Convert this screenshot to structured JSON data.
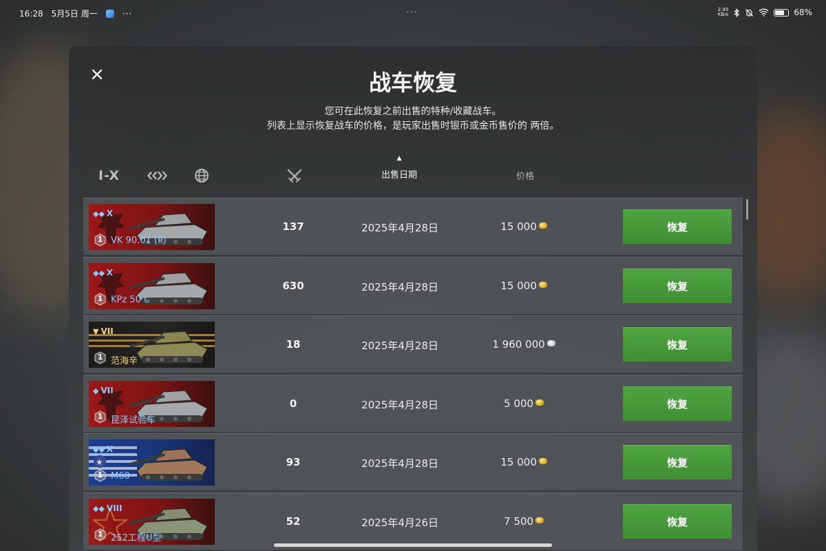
{
  "status_bar": {
    "time": "16:28",
    "date": "5月5日",
    "weekday": "周一",
    "net_speed_value": "2.95",
    "net_speed_unit": "KB/s",
    "battery_percent": "68%",
    "battery_level": 0.68
  },
  "dialog": {
    "title": "战车恢复",
    "description_line1": "您可在此恢复之前出售的特种/收藏战车。",
    "description_line2": "列表上显示恢复战车的价格，是玩家出售时银币或金币售价的 两倍。"
  },
  "filters": {
    "tier_label": "I-X",
    "nation_icon": "nation-filter-icon",
    "globe_icon": "globe-icon"
  },
  "columns": {
    "battles_icon": "crossed-swords-icon",
    "sale_date": "出售日期",
    "sale_date_sort": "▲",
    "price": "价格"
  },
  "colors": {
    "accent_green": "#4a9e3d",
    "premium_gold": "#f2d27a",
    "tier_blue": "#8ec8ff"
  },
  "vehicles": [
    {
      "tier_type": "◆◆",
      "tier": "X",
      "name": "VK 90.01 (P)",
      "rank": "1",
      "battles": "137",
      "date": "2025年4月28日",
      "price": "15 000",
      "currency": "gold",
      "button": "恢复",
      "flag": "germany"
    },
    {
      "tier_type": "◆◆",
      "tier": "X",
      "name": "KPz 50 t",
      "rank": "1",
      "battles": "630",
      "date": "2025年4月28日",
      "price": "15 000",
      "currency": "gold",
      "button": "恢复",
      "flag": "germany"
    },
    {
      "tier_type": "▼",
      "tier": "VII",
      "name": "范海辛",
      "rank": "1",
      "battles": "18",
      "date": "2025年4月28日",
      "price": "1 960 000",
      "currency": "silver",
      "button": "恢复",
      "flag": "premium"
    },
    {
      "tier_type": "◆",
      "tier": "VII",
      "name": "昆泽试验车",
      "rank": "1",
      "battles": "0",
      "date": "2025年4月28日",
      "price": "5 000",
      "currency": "gold",
      "button": "恢复",
      "flag": "germany"
    },
    {
      "tier_type": "◆◆",
      "tier": "X",
      "name": "M60",
      "rank": "1",
      "battles": "93",
      "date": "2025年4月28日",
      "price": "15 000",
      "currency": "gold",
      "button": "恢复",
      "flag": "usa"
    },
    {
      "tier_type": "◆◆",
      "tier": "VIII",
      "name": "252工程U型",
      "rank": "1",
      "battles": "52",
      "date": "2025年4月26日",
      "price": "7 500",
      "currency": "gold",
      "button": "恢复",
      "flag": "ussr"
    }
  ]
}
